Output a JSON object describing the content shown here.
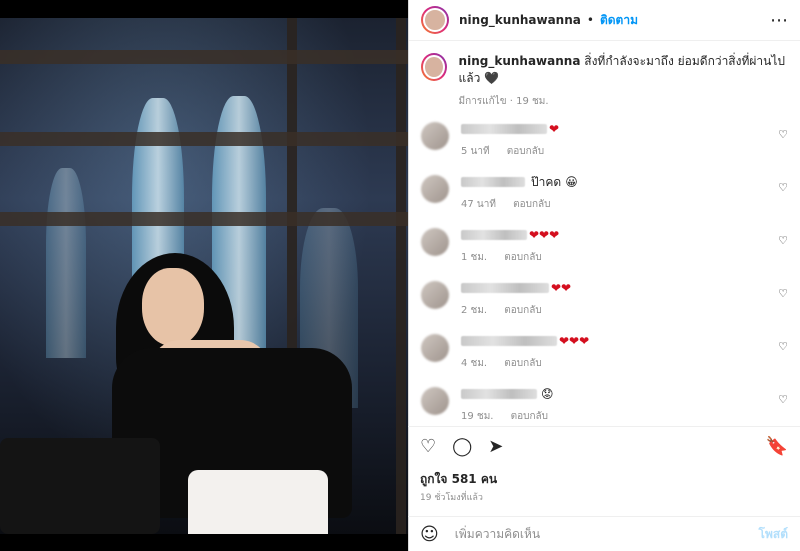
{
  "post": {
    "username": "ning_kunhawanna",
    "follow_label": "ติดตาม",
    "caption_text": "สิ่งที่กำลังจะมาถึง ย่อมดีกว่าสิ่งที่ผ่านไปแล้ว",
    "caption_meta": "มีการแก้ไข · 19 ชม."
  },
  "comments": [
    {
      "meta_time": "5 นาที",
      "reply": "ตอบกลับ",
      "text": "",
      "emoji": "❤"
    },
    {
      "meta_time": "47 นาที",
      "reply": "ตอบกลับ",
      "text": "ป๊าคด",
      "emoji": "😀"
    },
    {
      "meta_time": "1 ชม.",
      "reply": "ตอบกลับ",
      "text": "",
      "emoji": "❤❤❤"
    },
    {
      "meta_time": "2 ชม.",
      "reply": "ตอบกลับ",
      "text": "",
      "emoji": "❤❤"
    },
    {
      "meta_time": "4 ชม.",
      "reply": "ตอบกลับ",
      "text": "",
      "emoji": "❤❤❤"
    },
    {
      "meta_time": "19 ชม.",
      "reply": "ตอบกลับ",
      "text": "",
      "emoji": "😟"
    }
  ],
  "footer": {
    "likes": "ถูกใจ 581 คน",
    "ago": "19 ชั่วโมงที่แล้ว",
    "add_comment": "เพิ่มความคิดเห็น",
    "post_btn": "โพสต์"
  },
  "icons": {
    "heart": "heart-icon",
    "comment": "comment-icon",
    "share": "share-icon",
    "bookmark": "bookmark-icon",
    "emoji": "emoji-icon",
    "more": "more-icon",
    "like_small": "heart-outline-icon"
  },
  "colors": {
    "follow": "#0095f6",
    "heart": "#d40f1f",
    "muted": "#8e8e8e"
  }
}
